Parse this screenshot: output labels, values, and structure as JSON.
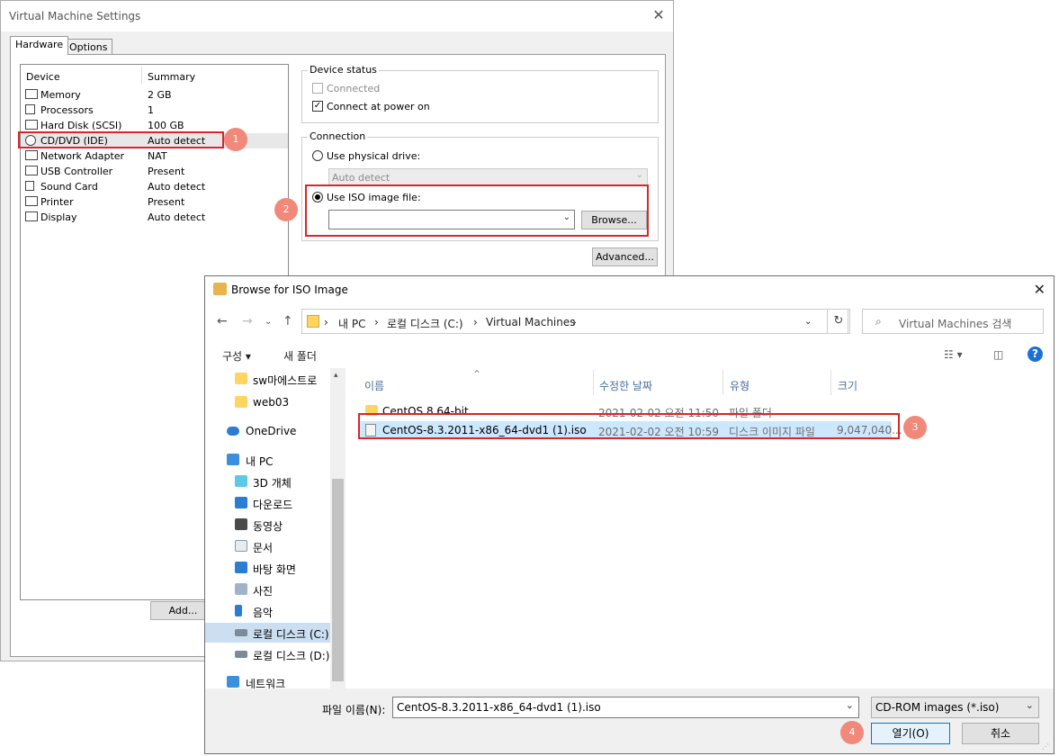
{
  "vm": {
    "title": "Virtual Machine Settings",
    "tabs": [
      "Hardware",
      "Options"
    ],
    "device_list": {
      "headers": [
        "Device",
        "Summary"
      ],
      "items": [
        {
          "name": "Memory",
          "summary": "2 GB"
        },
        {
          "name": "Processors",
          "summary": "1"
        },
        {
          "name": "Hard Disk (SCSI)",
          "summary": "100 GB"
        },
        {
          "name": "CD/DVD (IDE)",
          "summary": "Auto detect"
        },
        {
          "name": "Network Adapter",
          "summary": "NAT"
        },
        {
          "name": "USB Controller",
          "summary": "Present"
        },
        {
          "name": "Sound Card",
          "summary": "Auto detect"
        },
        {
          "name": "Printer",
          "summary": "Present"
        },
        {
          "name": "Display",
          "summary": "Auto detect"
        }
      ],
      "add_label": "Add..."
    },
    "device_status": {
      "title": "Device status",
      "connected_label": "Connected",
      "connect_power_label": "Connect at power on",
      "connected_checked": false,
      "connect_power_checked": true
    },
    "connection": {
      "title": "Connection",
      "physical_label": "Use physical drive:",
      "physical_value": "Auto detect",
      "iso_label": "Use ISO image file:",
      "iso_value": "",
      "browse_label": "Browse...",
      "selected": "iso"
    },
    "advanced_label": "Advanced..."
  },
  "annotations": [
    "1",
    "2",
    "3",
    "4"
  ],
  "browse": {
    "title": "Browse for ISO Image",
    "breadcrumbs": [
      "내 PC",
      "로컬 디스크 (C:)",
      "Virtual Machines"
    ],
    "search_placeholder": "Virtual Machines 검색",
    "toolbar": {
      "organize": "구성 ▾",
      "new_folder": "새 폴더"
    },
    "nav_items": [
      {
        "label": "sw마에스트로",
        "icon": "folder-icon"
      },
      {
        "label": "web03",
        "icon": "folder-icon"
      },
      {
        "label": "OneDrive",
        "icon": "cloud-icon"
      },
      {
        "label": "내 PC",
        "icon": "computer-icon"
      },
      {
        "label": "3D 개체",
        "icon": "cube-icon"
      },
      {
        "label": "다운로드",
        "icon": "download-icon"
      },
      {
        "label": "동영상",
        "icon": "video-icon"
      },
      {
        "label": "문서",
        "icon": "document-icon"
      },
      {
        "label": "바탕 화면",
        "icon": "desktop-icon"
      },
      {
        "label": "사진",
        "icon": "picture-icon"
      },
      {
        "label": "음악",
        "icon": "music-icon"
      },
      {
        "label": "로컬 디스크 (C:)",
        "icon": "drive-icon"
      },
      {
        "label": "로컬 디스크 (D:)",
        "icon": "drive-icon"
      },
      {
        "label": "네트워크",
        "icon": "network-icon"
      }
    ],
    "columns": [
      "이름",
      "수정한 날짜",
      "유형",
      "크기"
    ],
    "files": [
      {
        "name": "CentOS 8 64-bit",
        "date": "2021-02-02 오전 11:50",
        "type": "파일 폴더",
        "size": ""
      },
      {
        "name": "CentOS-8.3.2011-x86_64-dvd1 (1).iso",
        "date": "2021-02-02 오전 10:59",
        "type": "디스크 이미지 파일",
        "size": "9,047,040..."
      }
    ],
    "filename_label": "파일 이름(N):",
    "filename_value": "CentOS-8.3.2011-x86_64-dvd1 (1).iso",
    "filetype_value": "CD-ROM images (*.iso)",
    "open_label": "열기(O)",
    "cancel_label": "취소"
  },
  "colors": {
    "highlight_red": "#d9262b",
    "badge": "#f0897a",
    "selection": "#cce8ff"
  }
}
